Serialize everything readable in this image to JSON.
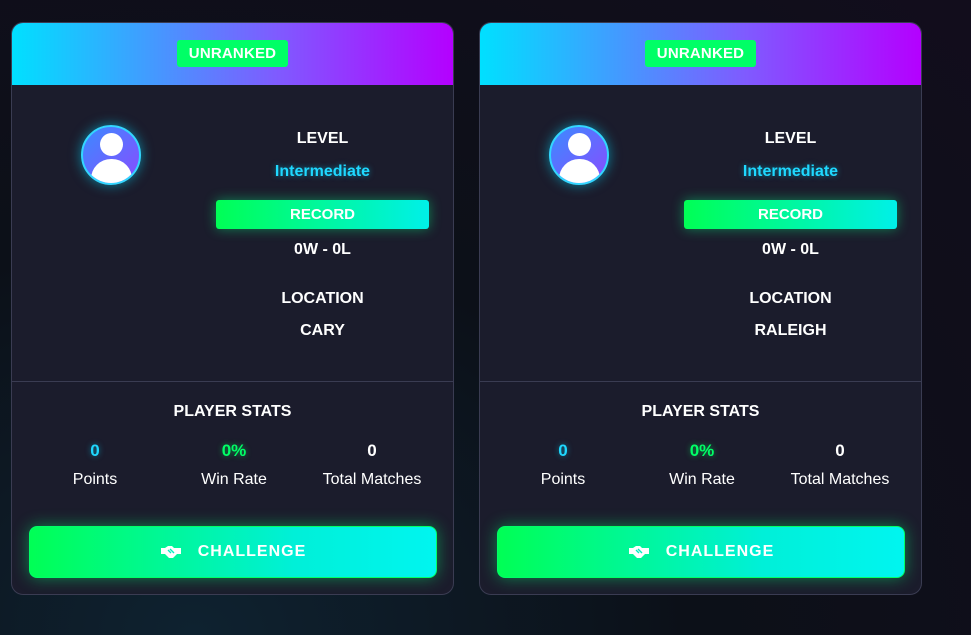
{
  "players": [
    {
      "rank_badge": "UNRANKED",
      "level_label": "LEVEL",
      "level_value": "Intermediate",
      "record_label": "RECORD",
      "record_value": "0W - 0L",
      "location_label": "LOCATION",
      "location_value": "CARY",
      "avatar_icon": "user-avatar-icon",
      "stats_title": "PLAYER STATS",
      "stats": {
        "points_value": "0",
        "points_label": "Points",
        "win_rate_value": "0%",
        "win_rate_label": "Win Rate",
        "total_matches_value": "0",
        "total_matches_label": "Total Matches"
      },
      "challenge_label": "CHALLENGE",
      "challenge_icon": "handshake-icon"
    },
    {
      "rank_badge": "UNRANKED",
      "level_label": "LEVEL",
      "level_value": "Intermediate",
      "record_label": "RECORD",
      "record_value": "0W - 0L",
      "location_label": "LOCATION",
      "location_value": "RALEIGH",
      "avatar_icon": "user-avatar-icon",
      "stats_title": "PLAYER STATS",
      "stats": {
        "points_value": "0",
        "points_label": "Points",
        "win_rate_value": "0%",
        "win_rate_label": "Win Rate",
        "total_matches_value": "0",
        "total_matches_label": "Total Matches"
      },
      "challenge_label": "CHALLENGE",
      "challenge_icon": "handshake-icon"
    }
  ],
  "colors": {
    "accent_cyan": "#1fd8ff",
    "accent_green": "#00ff66",
    "header_gradient_start": "#00e0ff",
    "header_gradient_end": "#b400ff",
    "card_background": "#1b1c2c"
  }
}
